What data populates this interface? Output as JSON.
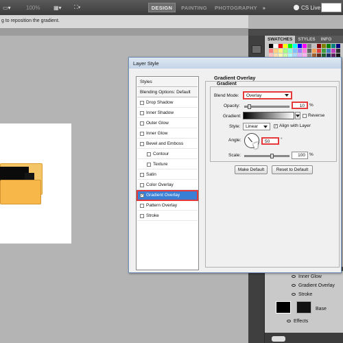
{
  "appbar": {
    "zoom": "100%",
    "workspaces": [
      {
        "label": "DESIGN",
        "active": true
      },
      {
        "label": "PAINTING",
        "active": false
      },
      {
        "label": "PHOTOGRAPHY",
        "active": false
      }
    ],
    "more": "»",
    "cs_live": "CS Live",
    "cs_live_arrow": "▾"
  },
  "options_bar": {
    "hint": "g to reposition the gradient."
  },
  "right_panel": {
    "tabs": [
      {
        "label": "SWATCHES",
        "active": true
      },
      {
        "label": "STYLES",
        "active": false
      },
      {
        "label": "INFO",
        "active": false
      }
    ],
    "swatch_colors": [
      "#000000",
      "#ffffff",
      "#ff0000",
      "#ffff00",
      "#00ff00",
      "#00ffff",
      "#0000ff",
      "#ff00ff",
      "#808080",
      "#c0c0c0",
      "#800000",
      "#808000",
      "#008000",
      "#008080",
      "#000080",
      "#ff8080",
      "#ffd080",
      "#fff080",
      "#a0ff80",
      "#80ffe0",
      "#80c0ff",
      "#a080ff",
      "#ff80e0",
      "#606060",
      "#f0a050",
      "#e04040",
      "#40a040",
      "#4080c0",
      "#c040c0",
      "#303030",
      "#ffc0c0",
      "#ffe0b0",
      "#fffab0",
      "#d0ffb0",
      "#b0ffff",
      "#b0d8ff",
      "#d8b0ff",
      "#ffb0f0",
      "#909090",
      "#a06030",
      "#603020",
      "#206030",
      "#203060",
      "#602060",
      "#1a1a1a"
    ],
    "effects": [
      "Inner Glow",
      "Gradient Overlay",
      "Stroke"
    ],
    "layer_name": "Base",
    "effects_label": "Effects"
  },
  "dialog": {
    "title": "Layer Style",
    "styles_list": [
      {
        "label": "Styles",
        "type": "header"
      },
      {
        "label": "Blending Options: Default",
        "type": "header"
      },
      {
        "label": "Drop Shadow",
        "checked": false
      },
      {
        "label": "Inner Shadow",
        "checked": false
      },
      {
        "label": "Outer Glow",
        "checked": false
      },
      {
        "label": "Inner Glow",
        "checked": false
      },
      {
        "label": "Bevel and Emboss",
        "checked": false
      },
      {
        "label": "Contour",
        "checked": false,
        "indent": true
      },
      {
        "label": "Texture",
        "checked": false,
        "indent": true
      },
      {
        "label": "Satin",
        "checked": false
      },
      {
        "label": "Color Overlay",
        "checked": false
      },
      {
        "label": "Gradient Overlay",
        "checked": true,
        "selected": true
      },
      {
        "label": "Pattern Overlay",
        "checked": false
      },
      {
        "label": "Stroke",
        "checked": false
      }
    ],
    "panel_title": "Gradient Overlay",
    "group_title": "Gradient",
    "blend_mode_label": "Blend Mode:",
    "blend_mode_value": "Overlay",
    "opacity_label": "Opacity:",
    "opacity_value": "10",
    "opacity_unit": "%",
    "opacity_fraction": 0.1,
    "gradient_label": "Gradient:",
    "reverse_label": "Reverse",
    "reverse_checked": false,
    "style_label": "Style:",
    "style_value": "Linear",
    "align_label": "Align with Layer",
    "align_checked": true,
    "angle_label": "Angle:",
    "angle_value": "50",
    "angle_unit": "°",
    "scale_label": "Scale:",
    "scale_value": "100",
    "scale_unit": "%",
    "make_default": "Make Default",
    "reset_default": "Reset to Default"
  }
}
